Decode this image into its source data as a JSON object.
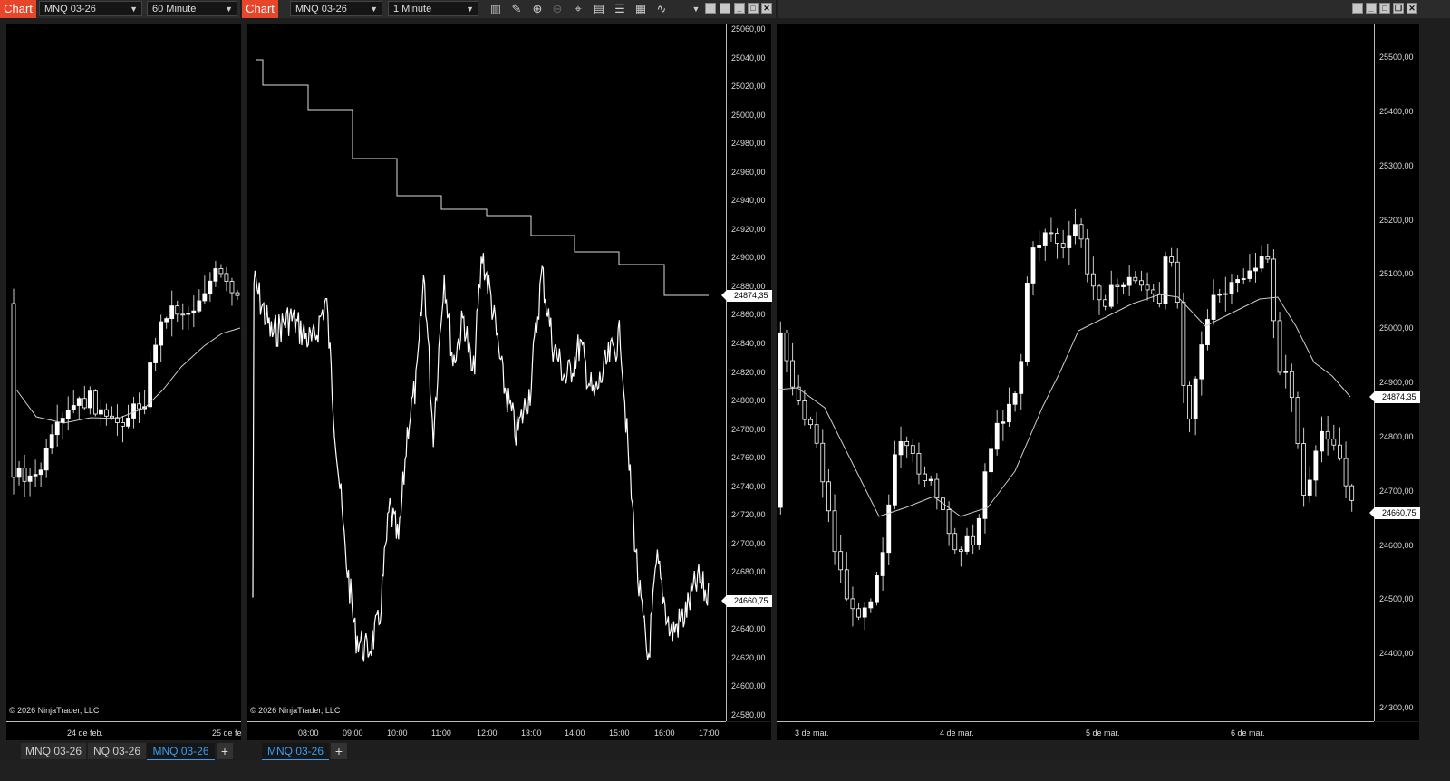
{
  "left": {
    "chart_label": "Chart",
    "instrument": "MNQ 03-26",
    "interval": "60 Minute",
    "x_labels": [
      "24 de feb.",
      "25 de fe"
    ],
    "copyright": "© 2026 NinjaTrader, LLC",
    "tabs": [
      "MNQ 03-26",
      "NQ 03-26",
      "MNQ 03-26"
    ],
    "tab_add": "+"
  },
  "middle": {
    "chart_label": "Chart",
    "instrument": "MNQ 03-26",
    "interval": "1 Minute",
    "copyright": "© 2026 NinjaTrader, LLC",
    "y_labels": [
      "25060,00",
      "25040,00",
      "25020,00",
      "25000,00",
      "24980,00",
      "24960,00",
      "24940,00",
      "24920,00",
      "24900,00",
      "24880,00",
      "24860,00",
      "24840,00",
      "24820,00",
      "24800,00",
      "24780,00",
      "24760,00",
      "24740,00",
      "24720,00",
      "24700,00",
      "24680,00",
      "24660,00",
      "24640,00",
      "24620,00",
      "24600,00",
      "24580,00"
    ],
    "x_labels": [
      "08:00",
      "09:00",
      "10:00",
      "11:00",
      "12:00",
      "13:00",
      "14:00",
      "15:00",
      "16:00",
      "17:00"
    ],
    "price_tags": [
      "24874,35",
      "24660,75"
    ],
    "tabs": [
      "MNQ 03-26"
    ],
    "tab_add": "+"
  },
  "right": {
    "y_labels": [
      "25500,00",
      "25400,00",
      "25300,00",
      "25200,00",
      "25100,00",
      "25000,00",
      "24900,00",
      "24800,00",
      "24700,00",
      "24600,00",
      "24500,00",
      "24400,00",
      "24300,00"
    ],
    "x_labels": [
      "3 de mar.",
      "4 de mar.",
      "5 de mar.",
      "6 de mar."
    ],
    "price_tags": [
      "24874,35",
      "24660,75"
    ]
  },
  "window_buttons": [
    "minimize",
    "maximize",
    "restore",
    "close"
  ],
  "colors": {
    "accent": "#e8462a",
    "tab_active": "#3a9ef0",
    "background": "#000000",
    "candle": "#ffffff"
  }
}
